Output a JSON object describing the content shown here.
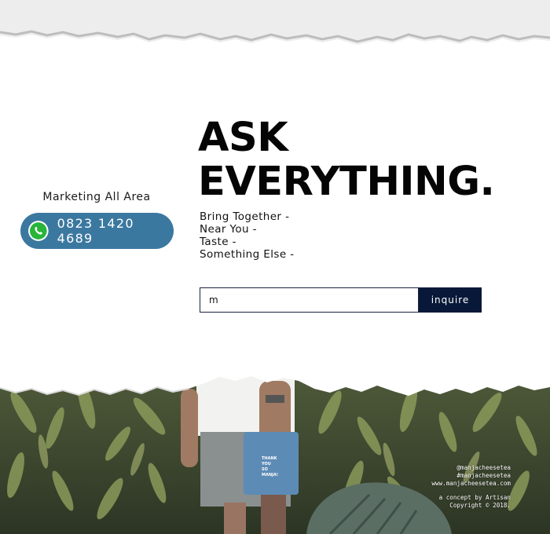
{
  "contact": {
    "area_label": "Marketing All Area",
    "whatsapp_number": "0823 1420 4689",
    "icon": "whatsapp-icon"
  },
  "hero": {
    "headline_line1": "ASK",
    "headline_line2": "EVERYTHING.",
    "taglines": [
      "Bring Together -",
      "Near You -",
      "Taste -",
      "Something Else -"
    ]
  },
  "inquiry": {
    "input_value": "m",
    "button_label": "inquire"
  },
  "photo": {
    "cup_text": "THANK YOU SO MANJA!"
  },
  "footer": {
    "instagram": "@manjacheesetea",
    "hashtag": "#manjacheesetea",
    "website": "www.manjacheesetea.com",
    "concept": "a concept by Artisan",
    "copyright": "Copyright © 2018."
  },
  "colors": {
    "pill": "#3b78a0",
    "button": "#081838",
    "whatsapp_green": "#29b43a"
  }
}
